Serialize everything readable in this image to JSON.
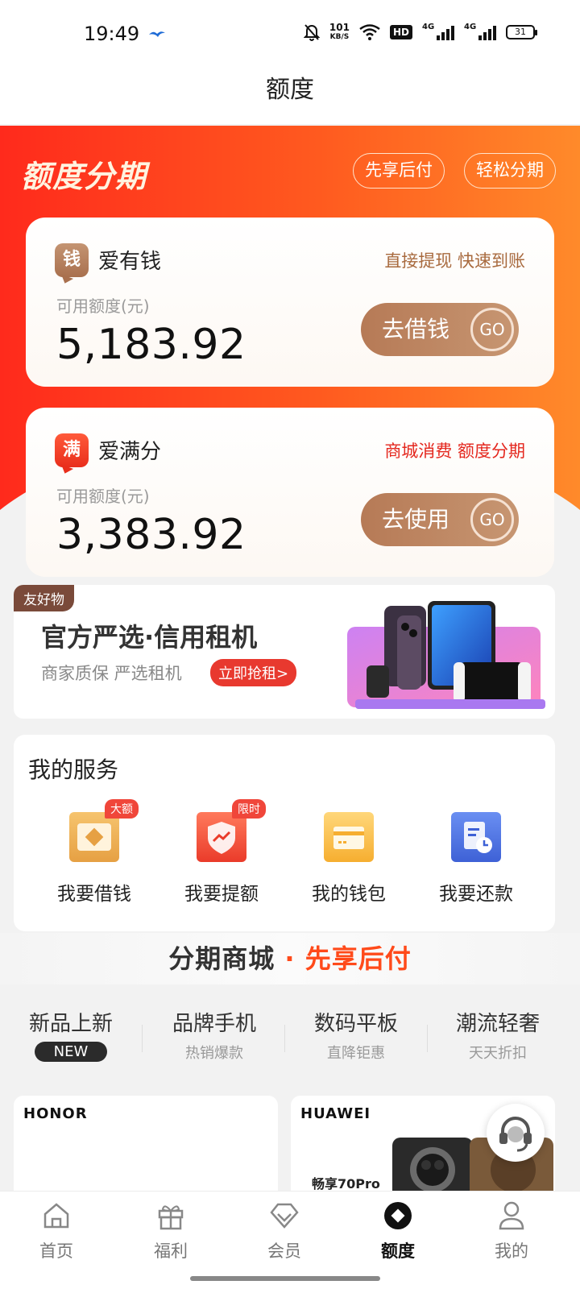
{
  "status_bar": {
    "time": "19:49",
    "speed_value": "101",
    "speed_unit": "KB/S",
    "hd": "HD",
    "net1": "4G",
    "net2": "4G",
    "battery": "31"
  },
  "header": {
    "title": "额度"
  },
  "hero": {
    "title": "额度分期",
    "pills": [
      "先享后付",
      "轻松分期"
    ]
  },
  "cards": [
    {
      "logo": "钱",
      "name": "爱有钱",
      "tagline": "直接提现 快速到账",
      "amount_label": "可用额度(元)",
      "amount": "5,183.92",
      "button": "去借钱",
      "go": "GO"
    },
    {
      "logo": "满",
      "name": "爱满分",
      "tagline": "商城消费 额度分期",
      "amount_label": "可用额度(元)",
      "amount": "3,383.92",
      "button": "去使用",
      "go": "GO"
    }
  ],
  "promo": {
    "tag": "友好物",
    "title": "官方严选·信用租机",
    "subtitle": "商家质保 严选租机",
    "cta": "立即抢租>"
  },
  "services": {
    "title": "我的服务",
    "items": [
      {
        "label": "我要借钱",
        "badge": "大额",
        "icon": "coin-icon",
        "color": "#e9a84c"
      },
      {
        "label": "我要提额",
        "badge": "限时",
        "icon": "shield-up-icon",
        "color": "#f0553f"
      },
      {
        "label": "我的钱包",
        "badge": "",
        "icon": "wallet-icon",
        "color": "#f8b53b"
      },
      {
        "label": "我要还款",
        "badge": "",
        "icon": "repay-clock-icon",
        "color": "#4a6ee0"
      }
    ]
  },
  "mall": {
    "title_a": "分期商城",
    "title_sep": " · ",
    "title_b": "先享后付",
    "tabs": [
      {
        "title": "新品上新",
        "sub": "NEW"
      },
      {
        "title": "品牌手机",
        "sub": "热销爆款"
      },
      {
        "title": "数码平板",
        "sub": "直降钜惠"
      },
      {
        "title": "潮流轻奢",
        "sub": "天天折扣"
      }
    ],
    "products": [
      {
        "brand": "HONOR",
        "model": ""
      },
      {
        "brand": "HUAWEI",
        "model": "畅享70Pro"
      }
    ]
  },
  "bottom_nav": [
    {
      "label": "首页",
      "icon": "home-icon",
      "active": false
    },
    {
      "label": "福利",
      "icon": "gift-icon",
      "active": false
    },
    {
      "label": "会员",
      "icon": "diamond-icon",
      "active": false
    },
    {
      "label": "额度",
      "icon": "quota-icon",
      "active": true
    },
    {
      "label": "我的",
      "icon": "profile-icon",
      "active": false
    }
  ],
  "colors": {
    "accent": "#ff4a1a",
    "brown": "#b67a56",
    "red": "#e4271e"
  }
}
